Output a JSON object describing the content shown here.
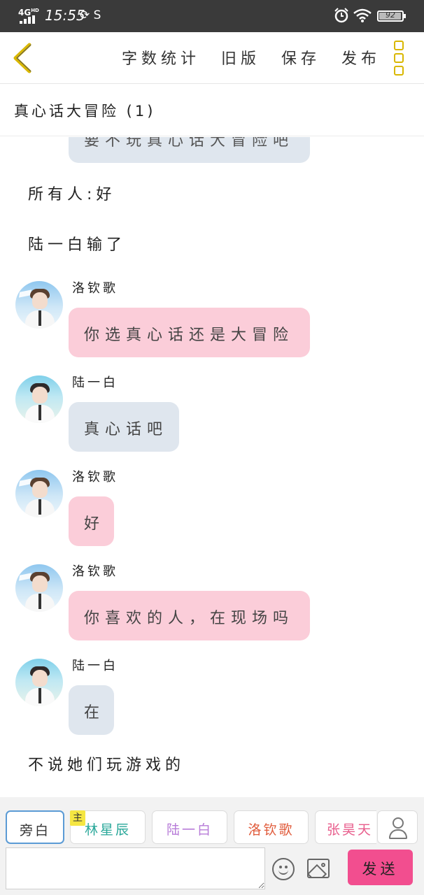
{
  "status_bar": {
    "network": "4G",
    "network_sup": "HD",
    "time": "15:55",
    "extra_icons": "⟳ S",
    "battery": "92"
  },
  "toolbar": {
    "word_count": "字数统计",
    "old_version": "旧版",
    "save": "保存",
    "publish": "发布",
    "accent_color": "#d9b700"
  },
  "chapter": {
    "title": "真心话大冒险 (1)"
  },
  "chat": {
    "partial_top_message": "要不玩真心话大冒险吧",
    "narration_1": "所有人:好",
    "narration_2": "陆一白输了",
    "messages": [
      {
        "name": "洛钦歌",
        "text": "你选真心话还是大冒险",
        "avatar": "avatar-luoqinge"
      },
      {
        "name": "陆一白",
        "text": "真心话吧",
        "avatar": "avatar-luyibai"
      },
      {
        "name": "洛钦歌",
        "text": "好",
        "avatar": "avatar-luoqinge"
      },
      {
        "name": "洛钦歌",
        "text": "你喜欢的人，在现场吗",
        "avatar": "avatar-luoqinge"
      },
      {
        "name": "陆一白",
        "text": "在",
        "avatar": "avatar-luyibai"
      }
    ],
    "narration_3": "不说她们玩游戏的",
    "bubble_colors": {
      "luoqinge": "#fbcdd9",
      "luyibai": "#dfe6ee"
    }
  },
  "composer": {
    "roles": [
      "旁白",
      "林星辰",
      "陆一白",
      "洛钦歌",
      "张昊天"
    ],
    "main_badge": "主",
    "input_value": "",
    "input_placeholder": "",
    "send": "发送",
    "send_color": "#f24e8f"
  }
}
